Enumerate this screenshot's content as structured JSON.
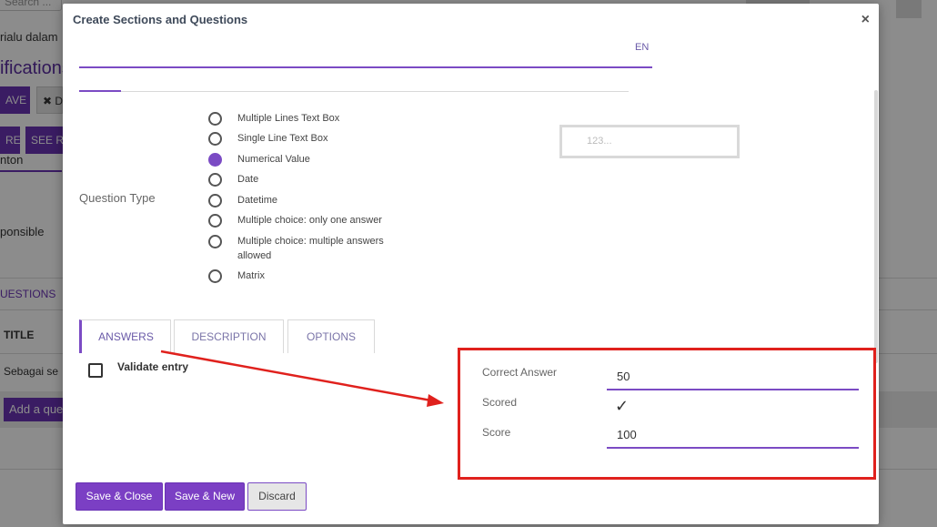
{
  "background": {
    "search_placeholder": "Search ...",
    "description_fragment": "rialu dalam",
    "heading_fragment": "ifications",
    "save_fragment": "AVE",
    "discard_fragment": "✖ D",
    "more_fragment": "RE",
    "see_fragment": "SEE RE",
    "field_fragment": "nton",
    "responsible_fragment": "ponsible",
    "questions_tab_fragment": "UESTIONS",
    "title_column": "TITLE",
    "row_fragment": "Sebagai se",
    "add_question_fragment": "Add a que"
  },
  "modal": {
    "title": "Create Sections and Questions",
    "close_symbol": "×",
    "title_input_value": "",
    "language": "EN",
    "question_type_label": "Question Type",
    "question_types": [
      {
        "label": "Multiple Lines Text Box",
        "checked": false
      },
      {
        "label": "Single Line Text Box",
        "checked": false
      },
      {
        "label": "Numerical Value",
        "checked": true
      },
      {
        "label": "Date",
        "checked": false
      },
      {
        "label": "Datetime",
        "checked": false
      },
      {
        "label": "Multiple choice: only one answer",
        "checked": false
      },
      {
        "label": "Multiple choice: multiple answers allowed",
        "checked": false
      },
      {
        "label": "Matrix",
        "checked": false
      }
    ],
    "numeric_placeholder": "123...",
    "tabs": [
      {
        "label": "ANSWERS",
        "active": true
      },
      {
        "label": "DESCRIPTION",
        "active": false
      },
      {
        "label": "OPTIONS",
        "active": false
      }
    ],
    "validate_entry_label": "Validate entry",
    "validate_entry_checked": false,
    "correct_answer_label": "Correct Answer",
    "correct_answer_value": "50",
    "scored_label": "Scored",
    "scored_checked": true,
    "scored_symbol": "✓",
    "score_label": "Score",
    "score_value": "100",
    "buttons": {
      "save_close": "Save & Close",
      "save_new": "Save & New",
      "discard": "Discard"
    }
  },
  "annotation_color": "#e0211d",
  "accent_color": "#7b4bc4"
}
